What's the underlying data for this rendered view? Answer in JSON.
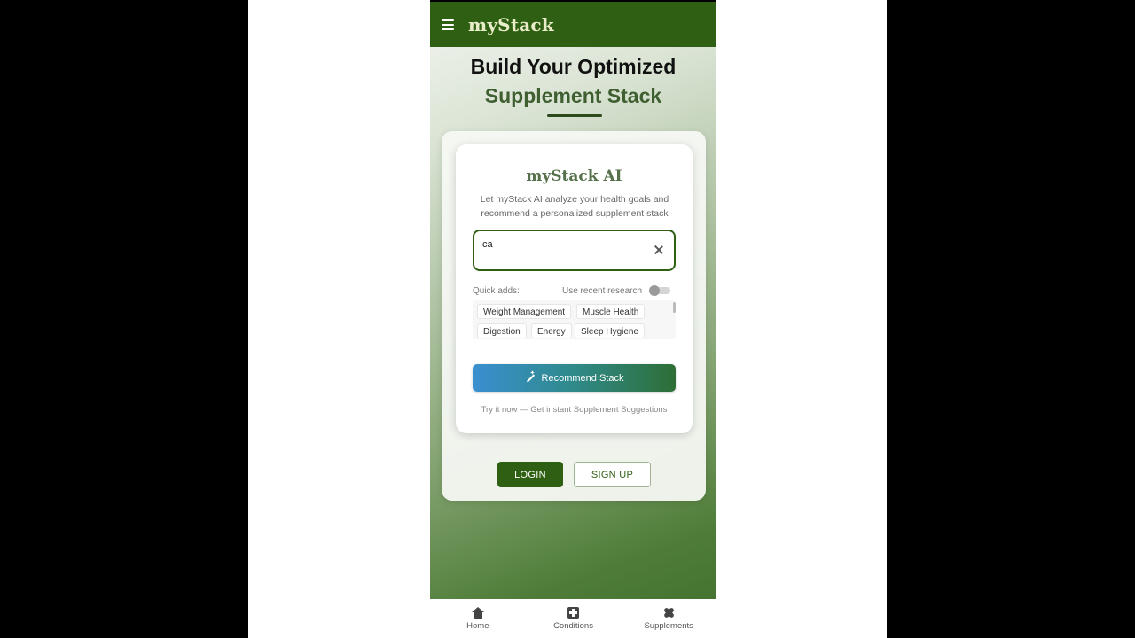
{
  "app": {
    "brand": "myStack"
  },
  "hero": {
    "title_line1": "Build Your Optimized",
    "title_line2": "Supplement Stack"
  },
  "ai_card": {
    "title": "myStack AI",
    "description": "Let myStack AI analyze your health goals and recommend a personalized supplement stack",
    "search_value": "ca",
    "quick_adds_label": "Quick adds:",
    "research_toggle_label": "Use recent research",
    "research_toggle_on": false,
    "quick_adds": [
      "Weight Management",
      "Muscle Health",
      "Digestion",
      "Energy",
      "Sleep Hygiene"
    ],
    "recommend_button": "Recommend Stack",
    "try_text": "Try it now — Get instant Supplement Suggestions"
  },
  "auth": {
    "login": "LOGIN",
    "signup": "SIGN UP"
  },
  "bottom_nav": {
    "items": [
      {
        "label": "Home",
        "icon": "home-icon"
      },
      {
        "label": "Conditions",
        "icon": "medical-icon"
      },
      {
        "label": "Supplements",
        "icon": "pill-icon"
      }
    ]
  },
  "colors": {
    "primary": "#2f5f12",
    "accent_blue": "#3a8fd0"
  }
}
